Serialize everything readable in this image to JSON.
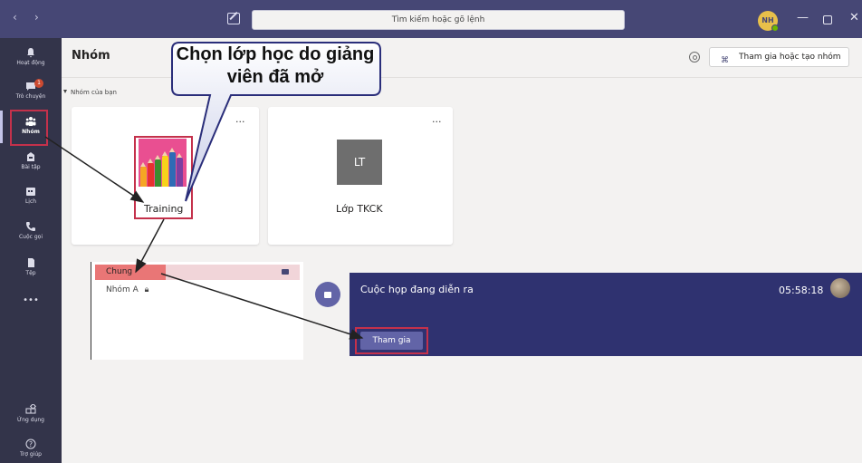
{
  "titlebar": {
    "back": "‹",
    "forward": "›",
    "search_placeholder": "Tìm kiếm hoặc gõ lệnh",
    "avatar_initials": "NH",
    "minimize": "—",
    "close": "✕"
  },
  "rail": {
    "items": [
      {
        "label": "Hoạt động",
        "icon": "bell-icon"
      },
      {
        "label": "Trò chuyện",
        "icon": "chat-icon",
        "badge": "1"
      },
      {
        "label": "Nhóm",
        "icon": "teams-icon",
        "active": true
      },
      {
        "label": "Bài tập",
        "icon": "assignment-icon"
      },
      {
        "label": "Lịch",
        "icon": "calendar-icon"
      },
      {
        "label": "Cuộc gọi",
        "icon": "phone-icon"
      },
      {
        "label": "Tệp",
        "icon": "file-icon"
      },
      {
        "label": "Ứng dụng",
        "icon": "apps-icon"
      },
      {
        "label": "Trợ giúp",
        "icon": "help-icon"
      }
    ],
    "more": "•••"
  },
  "header": {
    "title": "Nhóm",
    "join_create": "Tham gia hoặc tạo nhóm"
  },
  "section": {
    "label": "Nhóm của bạn"
  },
  "teams": [
    {
      "name": "Training",
      "more": "...",
      "icon": "pencils-image"
    },
    {
      "name": "Lớp TKCK",
      "more": "...",
      "initials": "LT"
    }
  ],
  "channels": [
    {
      "name": "Chung",
      "selected": true
    },
    {
      "name": "Nhóm A",
      "private": true
    }
  ],
  "meeting": {
    "title": "Cuộc họp đang diễn ra",
    "time": "05:58:18",
    "join": "Tham gia"
  },
  "callout": {
    "text": "Chọn lớp học do giảng viên đã mở"
  },
  "colors": {
    "titlebar": "#464775",
    "rail": "#33344a",
    "highlight": "#c4314b",
    "meeting_panel": "#2f3270",
    "accent": "#6264a7"
  }
}
